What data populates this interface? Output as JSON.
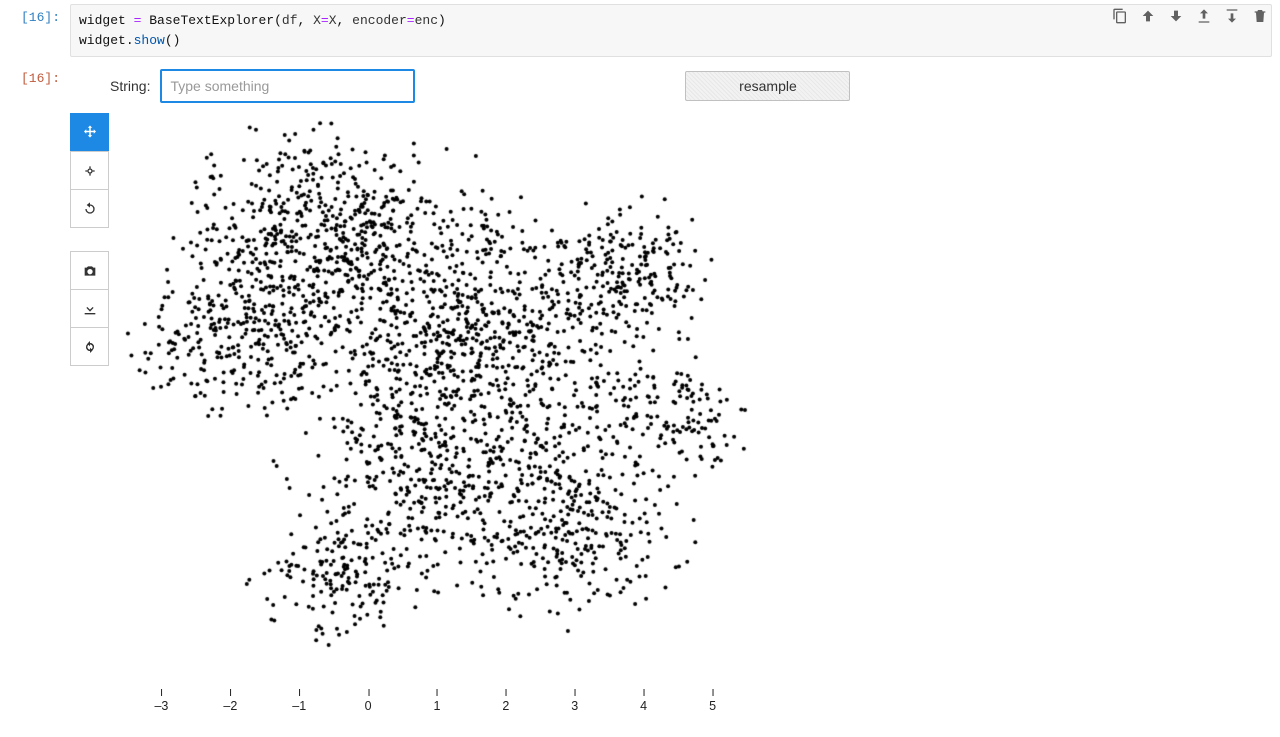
{
  "cells": {
    "input": {
      "prompt": "[16]:",
      "code_lines": [
        "widget = BaseTextExplorer(df, X=X, encoder=enc)",
        "widget.show()"
      ],
      "toolbar": {
        "duplicate": "Duplicate cell",
        "move_up": "Move up",
        "move_down": "Move down",
        "insert_above": "Insert above",
        "insert_below": "Insert below",
        "delete": "Delete cell"
      }
    },
    "output": {
      "prompt": "[16]:",
      "controls": {
        "string_label": "String:",
        "string_placeholder": "Type something",
        "resample_label": "resample"
      },
      "plot_toolbar": {
        "pan": "Pan",
        "box_zoom": "Box zoom",
        "reset": "Reset",
        "snapshot": "Snapshot",
        "save": "Save",
        "refresh": "Refresh"
      }
    }
  },
  "chart_data": {
    "type": "scatter",
    "title": "",
    "xlabel": "",
    "ylabel": "",
    "xlim": [
      -3.5,
      5.5
    ],
    "ylim": [
      -5.5,
      4.5
    ],
    "x_ticks": [
      -3,
      -2,
      -1,
      0,
      1,
      2,
      3,
      4,
      5
    ],
    "n_points": 2800,
    "marker": {
      "size": 2,
      "color": "#000000",
      "alpha": 1
    },
    "cluster_shape": "irregular-blob",
    "seed": 4219,
    "note": "Dense 2D embedding scatter. Individual point coordinates are not labeled in the image; points are pseudo-randomly distributed inside an irregular concave region roughly spanning x∈[-3,5], y∈[-5,4]."
  }
}
